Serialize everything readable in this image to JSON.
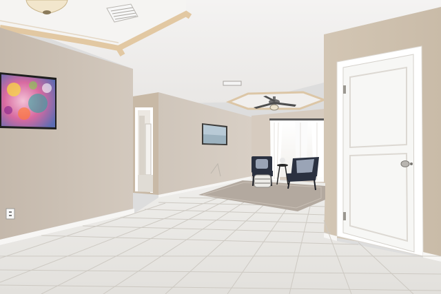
{
  "scene": {
    "kind": "interior-real-estate-photo",
    "elements": [
      "tray-ceiling",
      "ceiling-vent",
      "flush-mount-light",
      "ceiling-fan",
      "abstract-wall-art",
      "framed-wall-art",
      "hallway-doorway",
      "white-interior-door",
      "sheer-curtains",
      "accent-chairs",
      "area-rug",
      "tile-floor",
      "wall-outlet",
      "baseboards"
    ]
  },
  "colors": {
    "wall": "#cbbfb3",
    "ceiling": "#efedec",
    "tray_trim": "#e2c8a2",
    "floor": "#e8e6e2",
    "grout": "#c8c5bf",
    "door": "#f7f7f5",
    "rug": "#b6aca2",
    "chair": "#2b3140",
    "painting_main": "#d86aa0"
  }
}
